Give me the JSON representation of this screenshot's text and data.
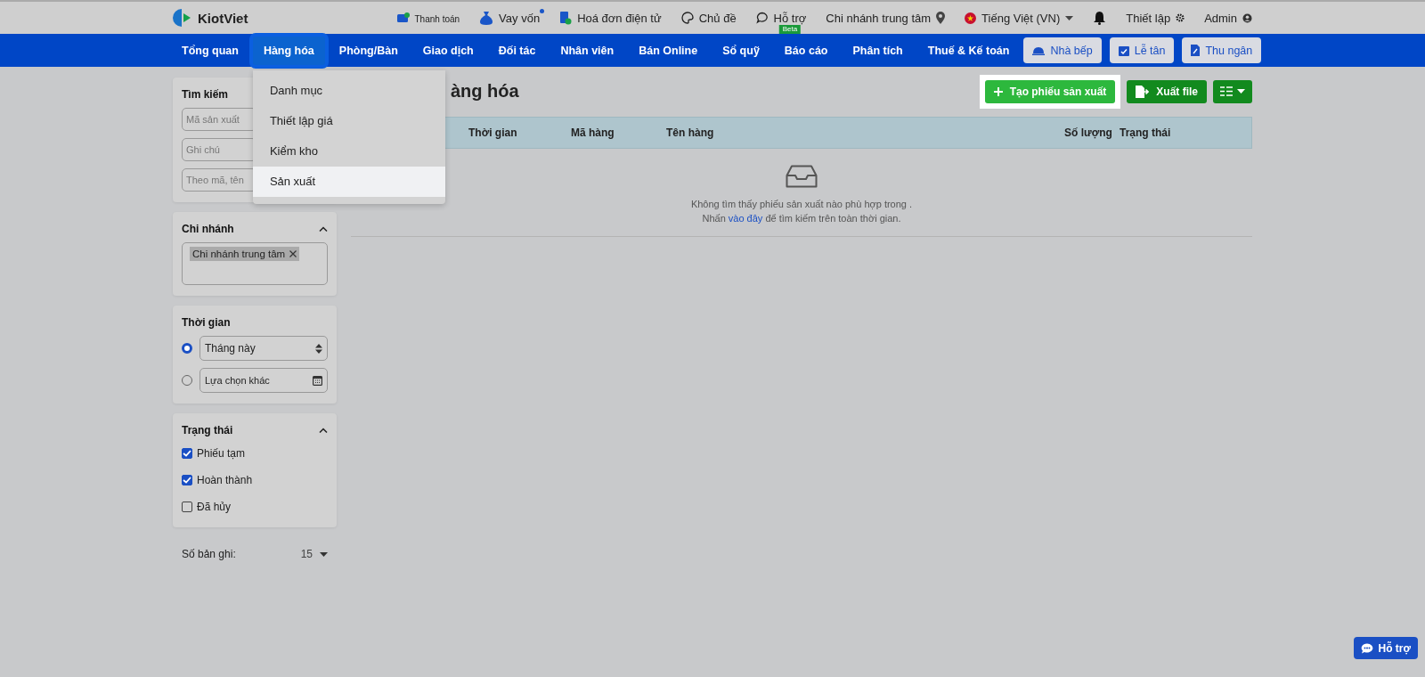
{
  "header": {
    "logo": "KiotViet",
    "links": [
      {
        "kind": "payment",
        "label": "Thanh toán",
        "dot": false
      },
      {
        "kind": "loan",
        "label": "Vay vốn",
        "dot": true
      },
      {
        "kind": "invoice",
        "label": "Hoá đơn điện tử",
        "dot": false
      },
      {
        "kind": "theme",
        "label": "Chủ đề",
        "dot": false
      },
      {
        "kind": "support",
        "label": "Hỗ trợ",
        "dot": false,
        "tag": "Beta"
      }
    ],
    "branch": "Chi nhánh trung tâm",
    "language": "Tiếng Việt (VN)",
    "settings": "Thiết lập",
    "user": "Admin"
  },
  "nav": {
    "items": [
      {
        "label": "Tổng quan",
        "selected": false
      },
      {
        "label": "Hàng hóa",
        "selected": true
      },
      {
        "label": "Phòng/Bàn",
        "selected": false
      },
      {
        "label": "Giao dịch",
        "selected": false
      },
      {
        "label": "Đối tác",
        "selected": false
      },
      {
        "label": "Nhân viên",
        "selected": false
      },
      {
        "label": "Bán Online",
        "selected": false
      },
      {
        "label": "Sổ quỹ",
        "selected": false
      },
      {
        "label": "Báo cáo",
        "selected": false
      },
      {
        "label": "Phân tích",
        "selected": false
      },
      {
        "label": "Thuế & Kế toán",
        "selected": false
      }
    ],
    "buttons": [
      {
        "kind": "kitchen",
        "label": "Nhà bếp"
      },
      {
        "kind": "reception",
        "label": "Lễ tân"
      },
      {
        "kind": "cashier",
        "label": "Thu ngân"
      }
    ]
  },
  "dropdown": {
    "items": [
      {
        "label": "Danh mục",
        "selected": false
      },
      {
        "label": "Thiết lập giá",
        "selected": false
      },
      {
        "label": "Kiểm kho",
        "selected": false
      },
      {
        "label": "Sản xuất",
        "selected": true
      }
    ]
  },
  "sidebar": {
    "search": {
      "title": "Tìm kiếm",
      "fields": [
        {
          "placeholder": "Mã sản xuất"
        },
        {
          "placeholder": "Ghi chú"
        },
        {
          "placeholder": "Theo mã, tên"
        }
      ]
    },
    "branch": {
      "title": "Chi nhánh",
      "expanded": true,
      "tags": [
        "Chi nhánh trung tâm"
      ]
    },
    "time": {
      "title": "Thời gian",
      "options": [
        {
          "kind": "select",
          "label": "Tháng này",
          "selected": true
        },
        {
          "kind": "date",
          "label": "Lựa chọn khác",
          "selected": false
        }
      ]
    },
    "status": {
      "title": "Trạng thái",
      "expanded": true,
      "options": [
        {
          "label": "Phiếu tạm",
          "checked": true
        },
        {
          "label": "Hoàn thành",
          "checked": true
        },
        {
          "label": "Đã hủy",
          "checked": false
        }
      ]
    },
    "records": {
      "label": "Số bản ghi:",
      "value": "15"
    }
  },
  "main": {
    "title": "àng hóa",
    "actions": [
      {
        "kind": "create",
        "label": "Tạo phiếu sản xuất",
        "highlighted": true
      },
      {
        "kind": "export",
        "label": "Xuất file",
        "highlighted": false
      },
      {
        "kind": "columns",
        "highlighted": false
      }
    ],
    "table": {
      "columns": [
        "Thời gian",
        "Mã hàng",
        "Tên hàng",
        "Số lượng",
        "Trạng thái"
      ]
    },
    "empty": {
      "line1": "Không tìm thấy phiếu sản xuất nào phù hợp trong .",
      "line2_before": "Nhấn ",
      "link": "vào đây",
      "line2_after": " để tìm kiếm trên toàn thời gian."
    }
  },
  "help_button": {
    "label": "Hỗ trợ"
  }
}
